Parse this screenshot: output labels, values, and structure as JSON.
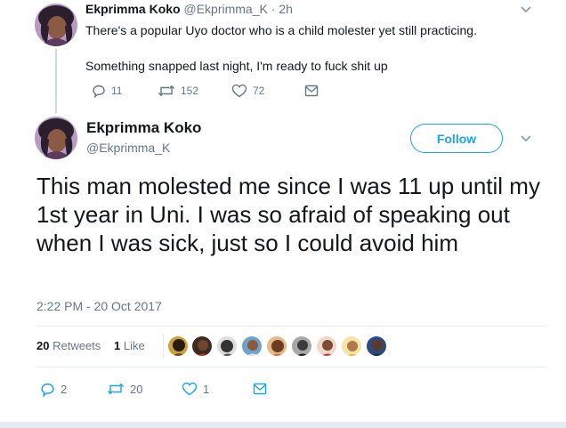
{
  "tweet1": {
    "display_name": "Ekprimma Koko",
    "handle": "@Ekprimma_K",
    "separator": "·",
    "time": "2h",
    "lines": [
      "There's a popular Uyo doctor who is a child molester yet still practicing.",
      "Something snapped last night, I'm ready to fuck shit up"
    ],
    "reply_count": "11",
    "retweet_count": "152",
    "like_count": "72",
    "icons": {
      "reply": "reply-icon",
      "retweet": "retweet-icon",
      "like": "heart-icon",
      "dm": "mail-icon",
      "more": "chevron-down-icon"
    }
  },
  "tweet2": {
    "display_name": "Ekprimma Koko",
    "handle": "@Ekprimma_K",
    "follow_label": "Follow",
    "text": "This man molested me since I was 11 up until my 1st year in Uni. I was so afraid of speaking out when I was sick, just so I could avoid him",
    "timestamp": "2:22 PM - 20 Oct 2017",
    "retweets_count": "20",
    "retweets_label": "Retweets",
    "likes_count": "1",
    "likes_label": "Like",
    "reply_count": "2",
    "retweet_count": "20",
    "like_count": "1",
    "likers": 9
  },
  "colors": {
    "accent": "#1da1f2",
    "text": "#14171a",
    "muted": "#657786",
    "divider": "#e6ecf0",
    "thread_line": "#c4dbea"
  }
}
